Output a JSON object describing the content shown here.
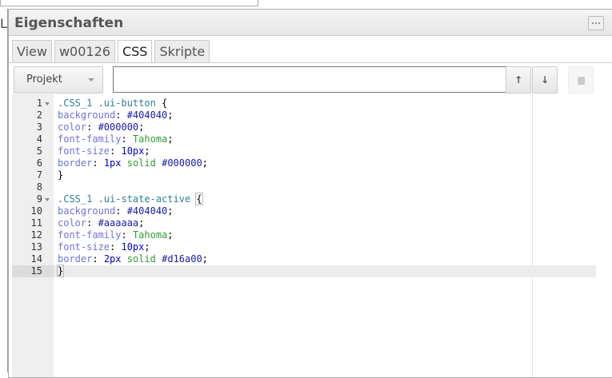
{
  "left_strip_letter": "L",
  "panel": {
    "title": "Eigenschaften",
    "tabs": [
      {
        "label": "View"
      },
      {
        "label": "w00126"
      },
      {
        "label": "CSS"
      },
      {
        "label": "Skripte"
      }
    ],
    "toolbar": {
      "dropdown": "Projekt",
      "input_value": "",
      "up": "up-arrow",
      "down": "down-arrow",
      "save": "save-icon"
    }
  },
  "editor": {
    "active_line": 15,
    "lines": [
      {
        "n": "1",
        "fold": true,
        "tokens": [
          [
            ".CSS_1 .ui-button ",
            "sel"
          ],
          [
            "{",
            "p"
          ]
        ]
      },
      {
        "n": "2",
        "tokens": [
          [
            "background",
            "prop"
          ],
          [
            ": ",
            "p"
          ],
          [
            "#404040",
            "hex"
          ],
          [
            ";",
            "p"
          ]
        ]
      },
      {
        "n": "3",
        "tokens": [
          [
            "color",
            "prop"
          ],
          [
            ": ",
            "p"
          ],
          [
            "#000000",
            "hex"
          ],
          [
            ";",
            "p"
          ]
        ]
      },
      {
        "n": "4",
        "tokens": [
          [
            "font-family",
            "prop"
          ],
          [
            ": ",
            "p"
          ],
          [
            "Tahoma",
            "kw"
          ],
          [
            ";",
            "p"
          ]
        ]
      },
      {
        "n": "5",
        "tokens": [
          [
            "font-size",
            "prop"
          ],
          [
            ": ",
            "p"
          ],
          [
            "10px",
            "num"
          ],
          [
            ";",
            "p"
          ]
        ]
      },
      {
        "n": "6",
        "tokens": [
          [
            "border",
            "prop"
          ],
          [
            ": ",
            "p"
          ],
          [
            "1px",
            "num"
          ],
          [
            " ",
            "p"
          ],
          [
            "solid",
            "kw"
          ],
          [
            " ",
            "p"
          ],
          [
            "#000000",
            "hex"
          ],
          [
            ";",
            "p"
          ]
        ]
      },
      {
        "n": "7",
        "tokens": [
          [
            "}",
            "p"
          ]
        ]
      },
      {
        "n": "8",
        "tokens": []
      },
      {
        "n": "9",
        "fold": true,
        "tokens": [
          [
            ".CSS_1 .ui-state-active ",
            "sel"
          ],
          [
            "{",
            "brk"
          ]
        ]
      },
      {
        "n": "10",
        "tokens": [
          [
            "background",
            "prop"
          ],
          [
            ": ",
            "p"
          ],
          [
            "#404040",
            "hex"
          ],
          [
            ";",
            "p"
          ]
        ]
      },
      {
        "n": "11",
        "tokens": [
          [
            "color",
            "prop"
          ],
          [
            ": ",
            "p"
          ],
          [
            "#aaaaaa",
            "hex"
          ],
          [
            ";",
            "p"
          ]
        ]
      },
      {
        "n": "12",
        "tokens": [
          [
            "font-family",
            "prop"
          ],
          [
            ": ",
            "p"
          ],
          [
            "Tahoma",
            "kw"
          ],
          [
            ";",
            "p"
          ]
        ]
      },
      {
        "n": "13",
        "tokens": [
          [
            "font-size",
            "prop"
          ],
          [
            ": ",
            "p"
          ],
          [
            "10px",
            "num"
          ],
          [
            ";",
            "p"
          ]
        ]
      },
      {
        "n": "14",
        "tokens": [
          [
            "border",
            "prop"
          ],
          [
            ": ",
            "p"
          ],
          [
            "2px",
            "num"
          ],
          [
            " ",
            "p"
          ],
          [
            "solid",
            "kw"
          ],
          [
            " ",
            "p"
          ],
          [
            "#d16a00",
            "hex"
          ],
          [
            ";",
            "p"
          ]
        ]
      },
      {
        "n": "15",
        "tokens": [
          [
            "}",
            "brk"
          ]
        ]
      }
    ]
  }
}
